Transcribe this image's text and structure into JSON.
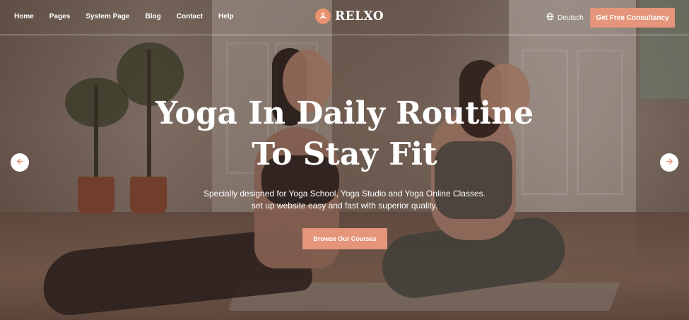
{
  "nav": {
    "items": [
      "Home",
      "Pages",
      "System Page",
      "Blog",
      "Contact",
      "Help"
    ]
  },
  "brand": {
    "name": "RELXO",
    "icon": "lotus-icon",
    "accent": "#e4957a"
  },
  "language": {
    "label": "Deutsch",
    "icon": "globe-icon"
  },
  "header_cta": {
    "label": "Get Free Consultancy"
  },
  "hero": {
    "title_line1": "Yoga In Daily Routine",
    "title_line2": "To Stay Fit",
    "subtitle_line1": "Specially designed for Yoga School, Yoga Studio and Yoga Online Classes.",
    "subtitle_line2": "set up website easy and fast with superior quality.",
    "cta_label": "Browse Our Courses"
  },
  "slider": {
    "prev_icon": "arrow-left-icon",
    "next_icon": "arrow-right-icon"
  }
}
